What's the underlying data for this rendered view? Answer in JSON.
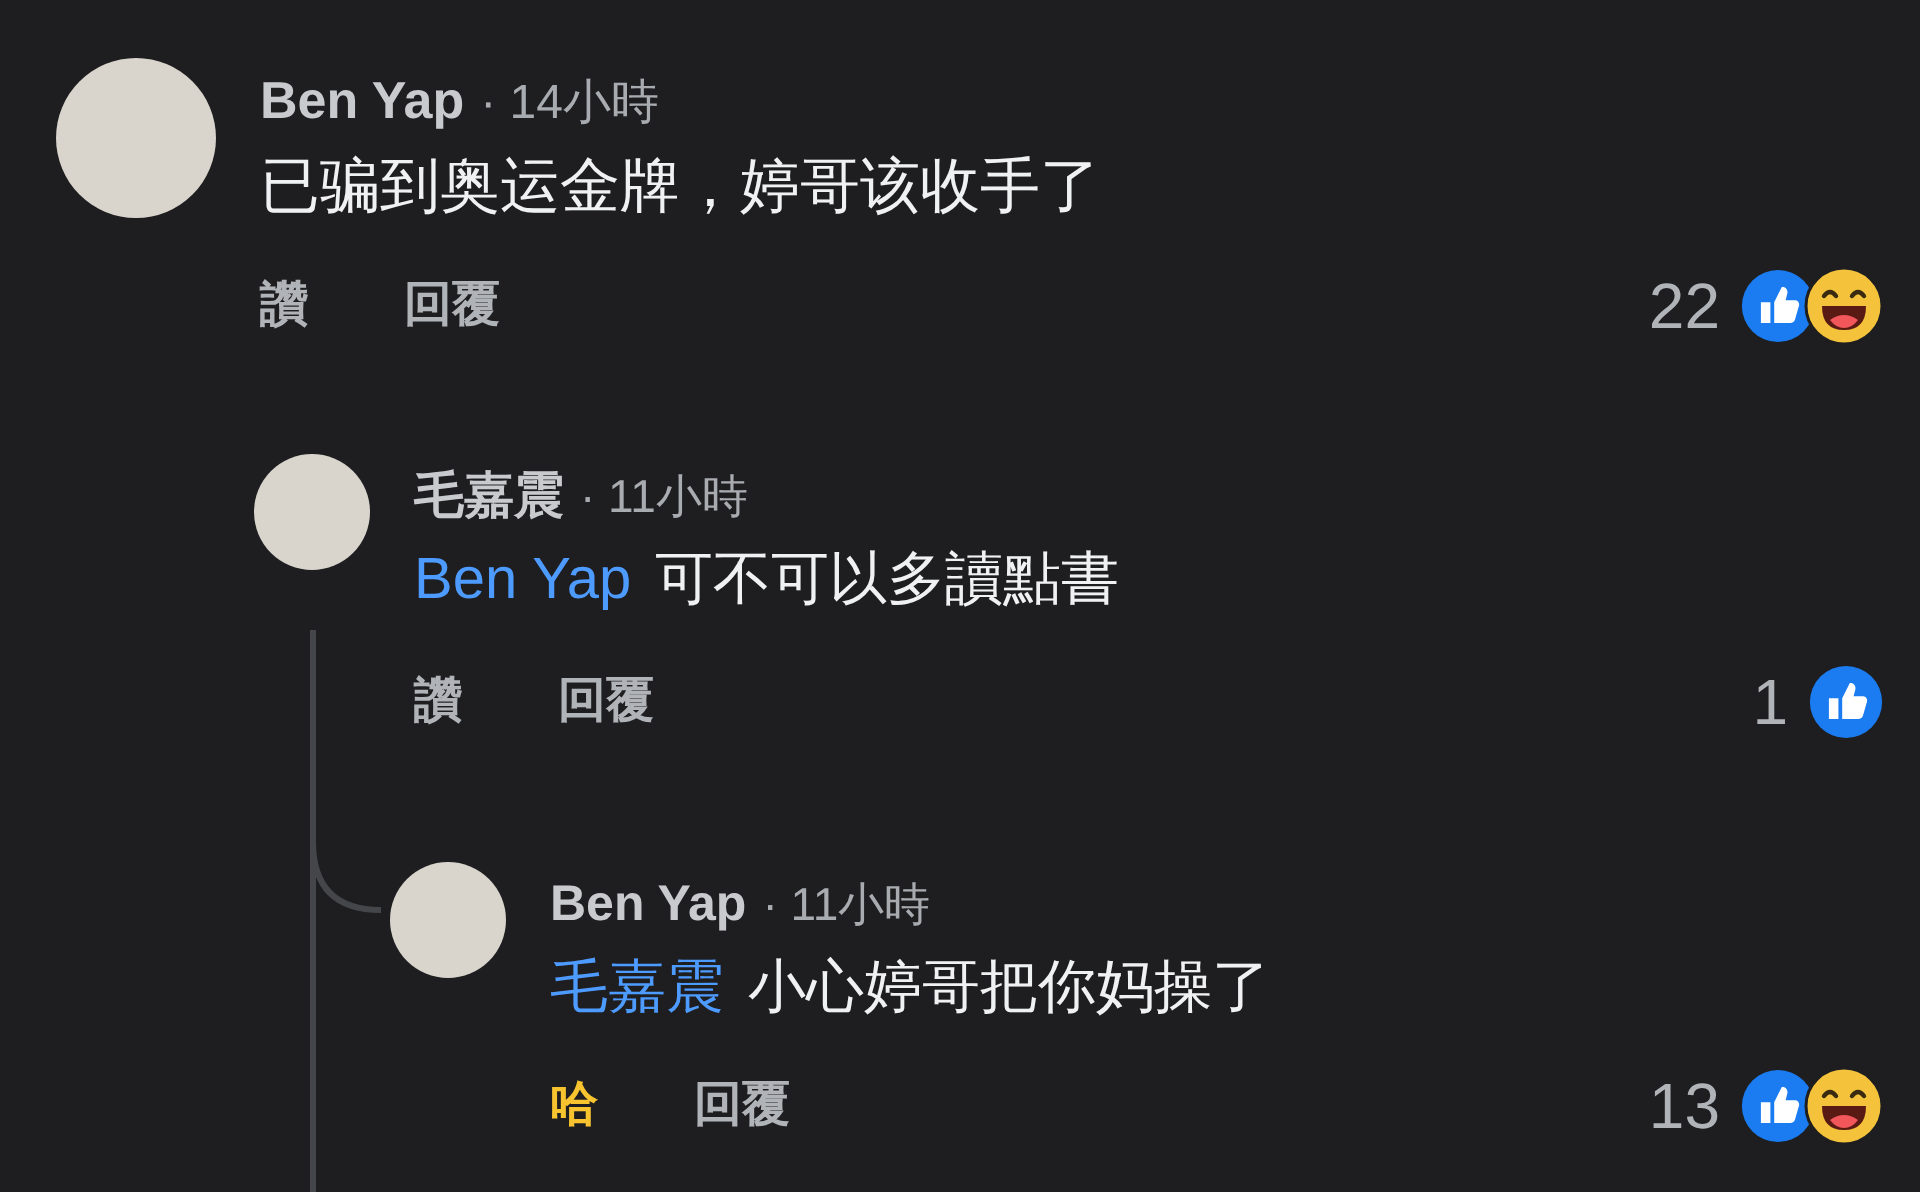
{
  "comments": [
    {
      "author": "Ben Yap",
      "time": "· 14小時",
      "text": "已骗到奥运金牌，婷哥该收手了",
      "like_label": "讚",
      "reacted": false,
      "reply_label": "回覆",
      "reaction_count": "22",
      "reactions": [
        {
          "kind": "like"
        },
        {
          "kind": "haha"
        }
      ],
      "children": [
        {
          "author": "毛嘉震",
          "time": "· 11小時",
          "mention": "Ben Yap",
          "text": "可不可以多讀點書",
          "like_label": "讚",
          "reacted": false,
          "reply_label": "回覆",
          "reaction_count": "1",
          "reactions": [
            {
              "kind": "like"
            }
          ],
          "children": [
            {
              "author": "Ben Yap",
              "time": "· 11小時",
              "mention": "毛嘉震",
              "text": "小心婷哥把你妈操了",
              "like_label": "哈",
              "reacted": true,
              "reply_label": "回覆",
              "reaction_count": "13",
              "reactions": [
                {
                  "kind": "like"
                },
                {
                  "kind": "haha"
                }
              ]
            }
          ]
        }
      ]
    }
  ]
}
